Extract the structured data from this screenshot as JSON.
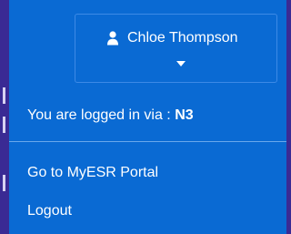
{
  "header": {
    "username": "Chloe Thompson",
    "user_icon": "user-icon",
    "dropdown_icon": "caret-down-icon"
  },
  "menu": {
    "login_prefix": "You are logged in via : ",
    "login_method": "N3",
    "items": [
      {
        "label": "Go to MyESR Portal"
      },
      {
        "label": "Logout"
      }
    ]
  },
  "colors": {
    "background": "#3a2a94",
    "panel": "#0a6ad3",
    "text": "#ffffff"
  }
}
